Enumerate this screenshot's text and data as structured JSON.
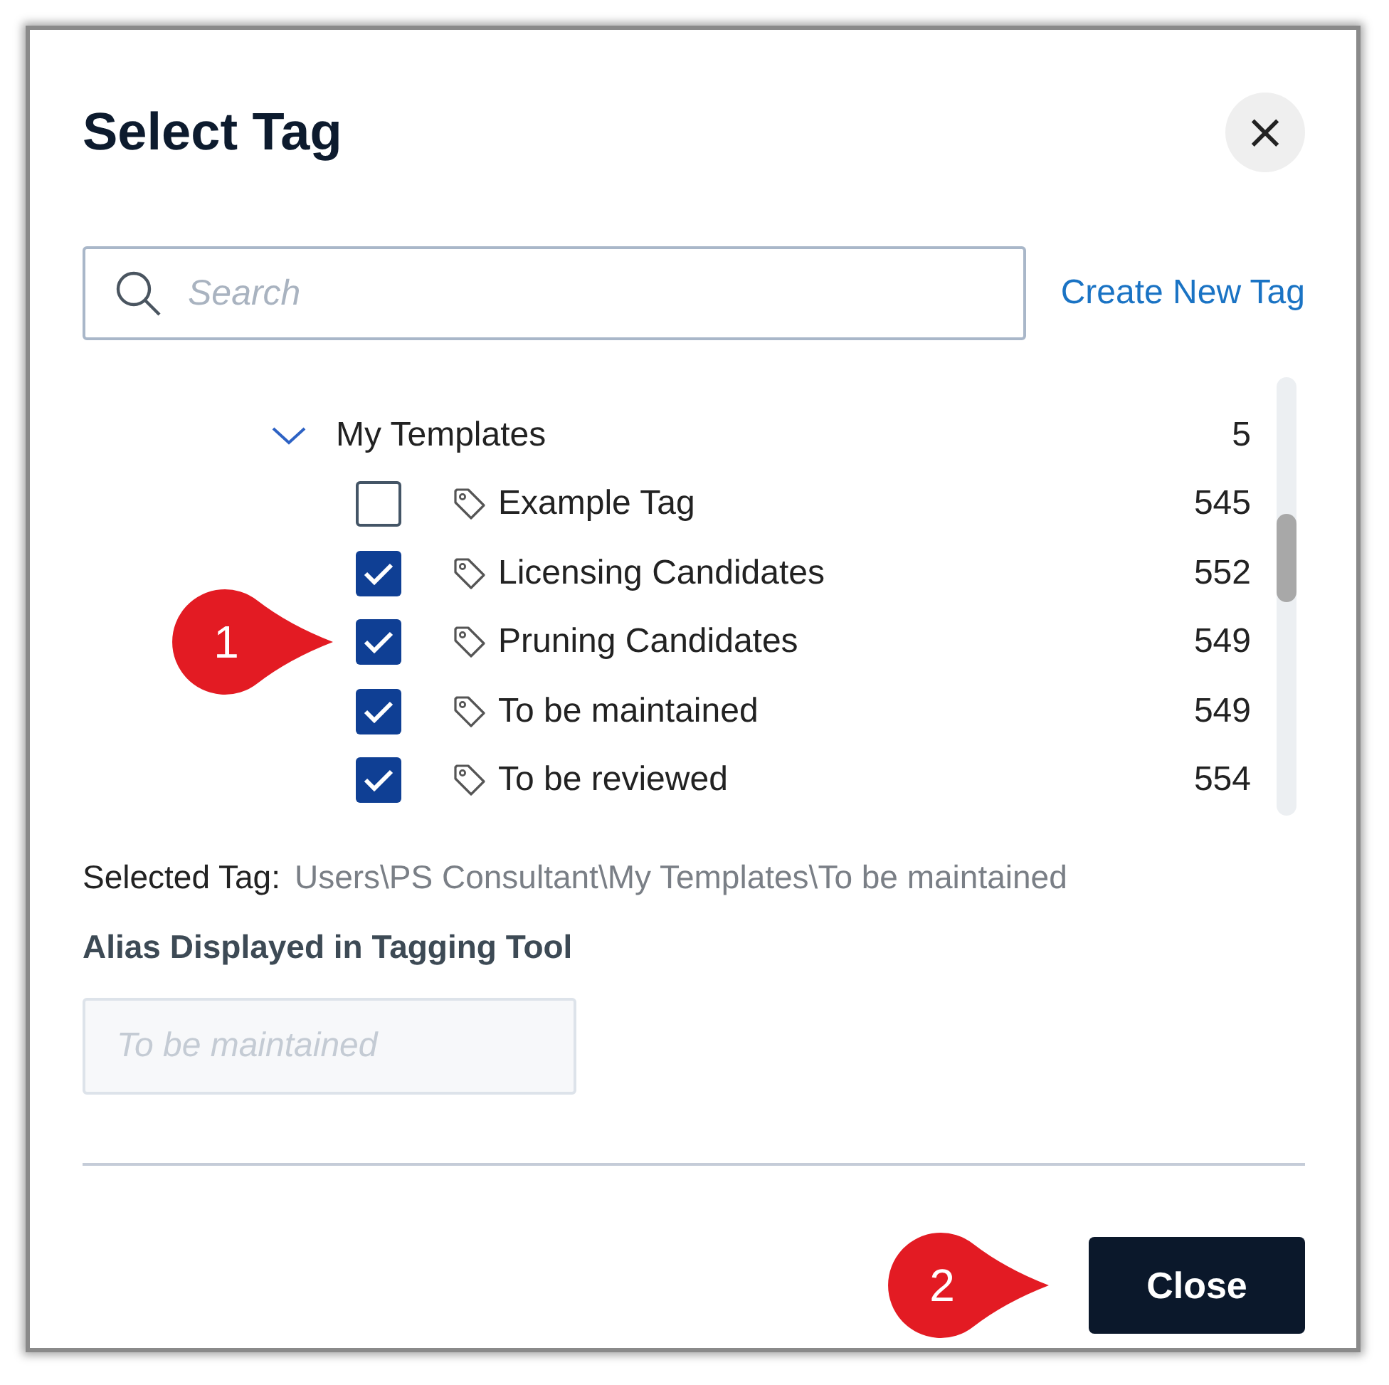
{
  "dialog": {
    "title": "Select Tag",
    "close_label": "×"
  },
  "search": {
    "placeholder": "Search"
  },
  "create_link": "Create New Tag",
  "tree": {
    "group": {
      "label": "My Templates",
      "count": "5",
      "expanded": true
    },
    "items": [
      {
        "label": "Example Tag",
        "count": "545",
        "checked": false
      },
      {
        "label": "Licensing Candidates",
        "count": "552",
        "checked": true
      },
      {
        "label": "Pruning Candidates",
        "count": "549",
        "checked": true
      },
      {
        "label": "To be maintained",
        "count": "549",
        "checked": true
      },
      {
        "label": "To be reviewed",
        "count": "554",
        "checked": true
      }
    ]
  },
  "selected_tag": {
    "label": "Selected Tag:",
    "path": "Users\\PS Consultant\\My Templates\\To be maintained"
  },
  "alias": {
    "label": "Alias Displayed in Tagging Tool",
    "placeholder": "To be maintained",
    "disabled": true
  },
  "buttons": [
    {
      "label": "Close"
    }
  ],
  "callouts": [
    {
      "label": "1"
    },
    {
      "label": "2"
    }
  ]
}
